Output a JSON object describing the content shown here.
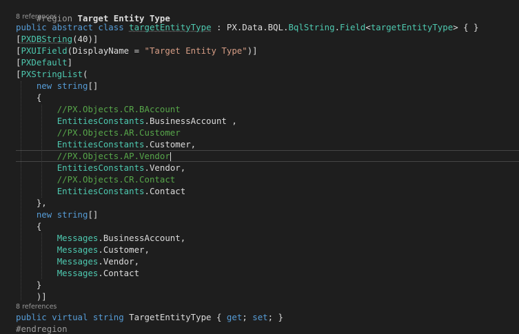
{
  "code": {
    "region_kw": "#region",
    "region_name": "Target Entity Type",
    "refs1": "8 references",
    "l_public1": "public",
    "l_abstract": "abstract",
    "l_class": "class",
    "l_classname": "targetEntityType",
    "l_colon": " : PX.Data.BQL.",
    "l_bqlstring": "BqlString",
    "l_dotfield": ".",
    "l_field": "Field",
    "l_lt": "<",
    "l_generic": "targetEntityType",
    "l_gt": "> { }",
    "a1_open": "[",
    "a1_name": "PXDBString",
    "a1_args": "(40)]",
    "a2_open": "[",
    "a2_name": "PXUIField",
    "a2_mid": "(DisplayName = ",
    "a2_str": "\"Target Entity Type\"",
    "a2_close": ")]",
    "a3_open": "[",
    "a3_name": "PXDefault",
    "a3_close": "]",
    "a4_open": "[",
    "a4_name": "PXStringList",
    "a4_paren": "(",
    "new1": "new",
    "string1": "string",
    "brackets1": "[]",
    "brace_open1": "{",
    "c1": "//PX.Objects.CR.BAccount",
    "e1_type": "EntitiesConstants",
    "e1_rest": ".BusinessAccount ,",
    "c2": "//PX.Objects.AR.Customer",
    "e2_type": "EntitiesConstants",
    "e2_rest": ".Customer,",
    "c3": "//PX.Objects.AP.Vendor",
    "e3_type": "EntitiesConstants",
    "e3_rest": ".Vendor,",
    "c4": "//PX.Objects.CR.Contact",
    "e4_type": "EntitiesConstants",
    "e4_rest": ".Contact",
    "brace_close1": "},",
    "new2": "new",
    "string2": "string",
    "brackets2": "[]",
    "brace_open2": "{",
    "m1_type": "Messages",
    "m1_rest": ".BusinessAccount,",
    "m2_type": "Messages",
    "m2_rest": ".Customer,",
    "m3_type": "Messages",
    "m3_rest": ".Vendor,",
    "m4_type": "Messages",
    "m4_rest": ".Contact",
    "brace_close2": "}",
    "close_list": ")]",
    "refs2": "8 references",
    "p_public": "public",
    "p_virtual": "virtual",
    "p_string": "string",
    "p_name": "TargetEntityType",
    "p_open": "{",
    "p_get": "get",
    "p_semi1": ";",
    "p_set": "set",
    "p_semi2": "; }",
    "endregion": "#endregion"
  },
  "colors": {
    "background": "#1e1e1e",
    "keyword": "#569cd6",
    "type": "#4ec9b0",
    "comment": "#57a64a",
    "string": "#d69d85",
    "text": "#dcdcdc"
  }
}
